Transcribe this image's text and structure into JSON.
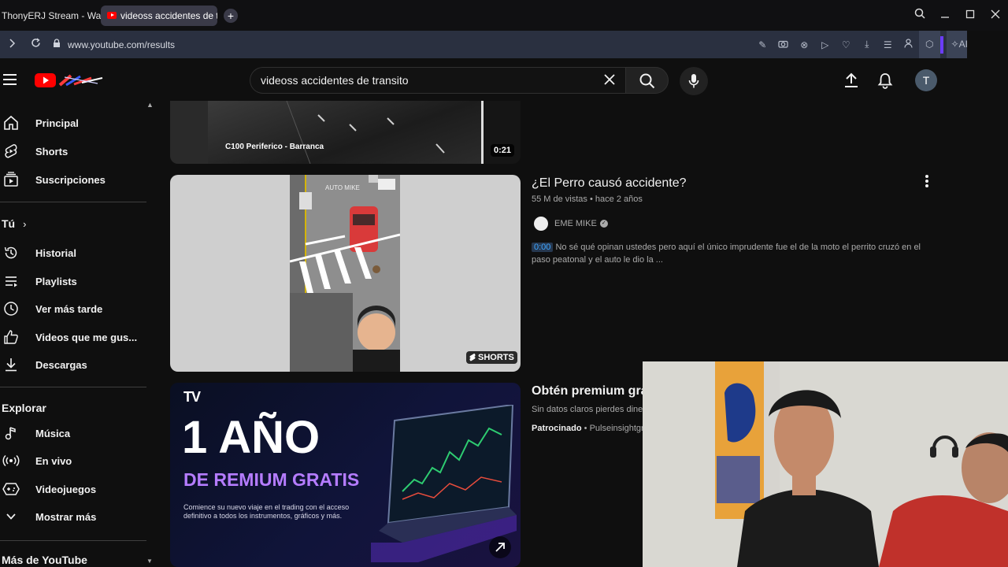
{
  "browser": {
    "tabs": [
      {
        "label": "ThonyERJ Stream - Watch"
      },
      {
        "label": "videoss accidentes de tran"
      }
    ],
    "new_tab": "+",
    "url": "www.youtube.com/results",
    "ai_label": "AI"
  },
  "youtube": {
    "search_query": "videoss accidentes de transito",
    "avatar_letter": "T"
  },
  "sidebar": {
    "main": [
      {
        "label": "Principal",
        "icon": "home-icon"
      },
      {
        "label": "Shorts",
        "icon": "shorts-icon"
      },
      {
        "label": "Suscripciones",
        "icon": "subscriptions-icon"
      }
    ],
    "you_title": "Tú",
    "you_items": [
      {
        "label": "Historial",
        "icon": "history-icon"
      },
      {
        "label": "Playlists",
        "icon": "playlists-icon"
      },
      {
        "label": "Ver más tarde",
        "icon": "watch-later-icon"
      },
      {
        "label": "Videos que me gus...",
        "icon": "like-icon"
      },
      {
        "label": "Descargas",
        "icon": "download-icon"
      }
    ],
    "explore_title": "Explorar",
    "explore_items": [
      {
        "label": "Música",
        "icon": "music-icon"
      },
      {
        "label": "En vivo",
        "icon": "live-icon"
      },
      {
        "label": "Videojuegos",
        "icon": "gaming-icon"
      },
      {
        "label": "Mostrar más",
        "icon": "chevron-down-icon"
      }
    ],
    "more_title": "Más de YouTube"
  },
  "results": {
    "top_video": {
      "overlay_text": "C100 Periferico - Barranca",
      "duration": "0:21"
    },
    "short_video": {
      "title": "¿El Perro causó accidente?",
      "views": "55 M de vistas",
      "age": "hace 2 años",
      "channel": "EME MIKE",
      "timestamp": "0:00",
      "description": "No sé qué opinan ustedes pero aquí el único imprudente fue el de la moto el perrito cruzó en el paso peatonal y el auto le dio la ...",
      "badge": "SHORTS",
      "watermark": "AUTO MIKE"
    },
    "ad": {
      "title": "Obtén premium grat",
      "subtitle": "Sin datos claros pierdes diner",
      "sponsored": "Patrocinado",
      "advertiser": "Pulseinsightgri",
      "banner_logo": "TV",
      "banner_line1": "1 AÑO",
      "banner_line2": "DE REMIUM GRATIS",
      "banner_small": "Comience su nuevo viaje en el trading con el acceso definitivo a todos los instrumentos, gráficos y más."
    }
  }
}
